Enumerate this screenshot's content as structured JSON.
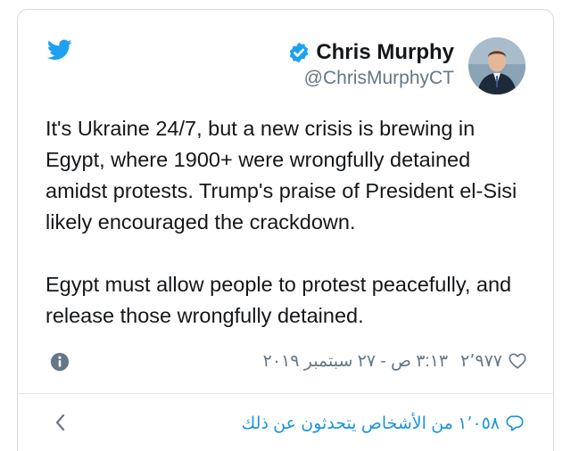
{
  "author": {
    "name": "Chris Murphy",
    "handle": "@ChrisMurphyCT",
    "verified_icon": "verified-badge-icon",
    "avatar": "avatar"
  },
  "brand": {
    "icon": "twitter-bird-icon",
    "color": "#1da1f2"
  },
  "tweet": {
    "text": "It's Ukraine 24/7, but a new crisis is brewing in Egypt, where 1900+ were wrongfully detained amidst protests. Trump's praise of President el-Sisi likely encouraged the crackdown.\n\nEgypt must allow people to protest peacefully, and release those wrongfully detained."
  },
  "meta": {
    "likes_count": "٢٬٩٧٧",
    "timestamp": "٣:١٣ ص - ٢٧ سبتمبر ٢٠١٩",
    "heart_icon": "heart-icon",
    "info_icon": "info-icon"
  },
  "footer": {
    "people_talking": "١٬٠٥٨ من الأشخاص يتحدثون عن ذلك",
    "bubble_icon": "reply-bubble-icon",
    "chevron_icon": "chevron-left-icon"
  },
  "colors": {
    "text": "#14171a",
    "secondary": "#657786",
    "link": "#1b95e0",
    "border": "#d8dde1"
  }
}
